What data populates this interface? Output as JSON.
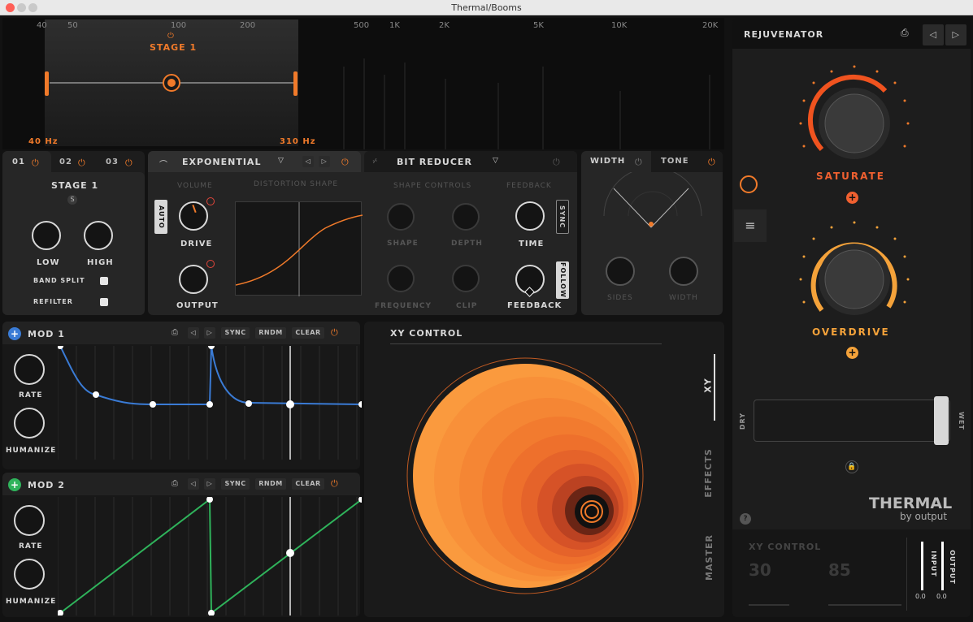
{
  "window": {
    "title": "Thermal/Booms"
  },
  "spectrum": {
    "freq_labels": [
      "40",
      "50",
      "100",
      "200",
      "500",
      "1K",
      "2K",
      "5K",
      "10K",
      "20K"
    ],
    "stage_label": "STAGE 1",
    "low_freq": "40 Hz",
    "high_freq": "310 Hz"
  },
  "stage_tabs": [
    "01",
    "02",
    "03"
  ],
  "stage_panel": {
    "title": "STAGE 1",
    "solo": "S",
    "low": "LOW",
    "high": "HIGH",
    "band_split": "BAND SPLIT",
    "refilter": "REFILTER"
  },
  "distortion": {
    "type": "EXPONENTIAL",
    "volume_label": "VOLUME",
    "shape_label": "DISTORTION SHAPE",
    "auto": "AUTO",
    "drive": "DRIVE",
    "output": "OUTPUT"
  },
  "bit_reducer": {
    "type": "BIT REDUCER",
    "shape_controls": "SHAPE CONTROLS",
    "feedback_label": "FEEDBACK",
    "shape": "SHAPE",
    "depth": "DEPTH",
    "frequency": "FREQUENCY",
    "clip": "CLIP",
    "time": "TIME",
    "feedback": "FEEDBACK",
    "sync": "SYNC",
    "follow": "FOLLOW"
  },
  "width_panel": {
    "tab_width": "WIDTH",
    "tab_tone": "TONE",
    "sides": "SIDES",
    "width": "WIDTH"
  },
  "mod1": {
    "title": "MOD 1",
    "sync": "SYNC",
    "rndm": "RNDM",
    "clear": "CLEAR",
    "rate": "RATE",
    "humanize": "HUMANIZE",
    "color": "#3a7bd5"
  },
  "mod2": {
    "title": "MOD 2",
    "sync": "SYNC",
    "rndm": "RNDM",
    "clear": "CLEAR",
    "rate": "RATE",
    "humanize": "HUMANIZE",
    "color": "#2fb35b"
  },
  "xy": {
    "title": "XY CONTROL",
    "tabs": [
      "XY",
      "EFFECTS",
      "MASTER"
    ]
  },
  "rejuvenator": {
    "title": "REJUVENATOR",
    "saturate": "SATURATE",
    "overdrive": "OVERDRIVE",
    "dry": "DRY",
    "wet": "WET",
    "logo": "THERMAL",
    "logo_by": "by output"
  },
  "footer": {
    "title": "XY CONTROL",
    "val1": "30",
    "val2": "85",
    "input_label": "INPUT",
    "output_label": "OUTPUT",
    "input_val": "0.0",
    "output_val": "0.0"
  },
  "colors": {
    "accent": "#f07a2a",
    "mod1": "#3a7bd5",
    "mod2": "#2fb35b"
  }
}
